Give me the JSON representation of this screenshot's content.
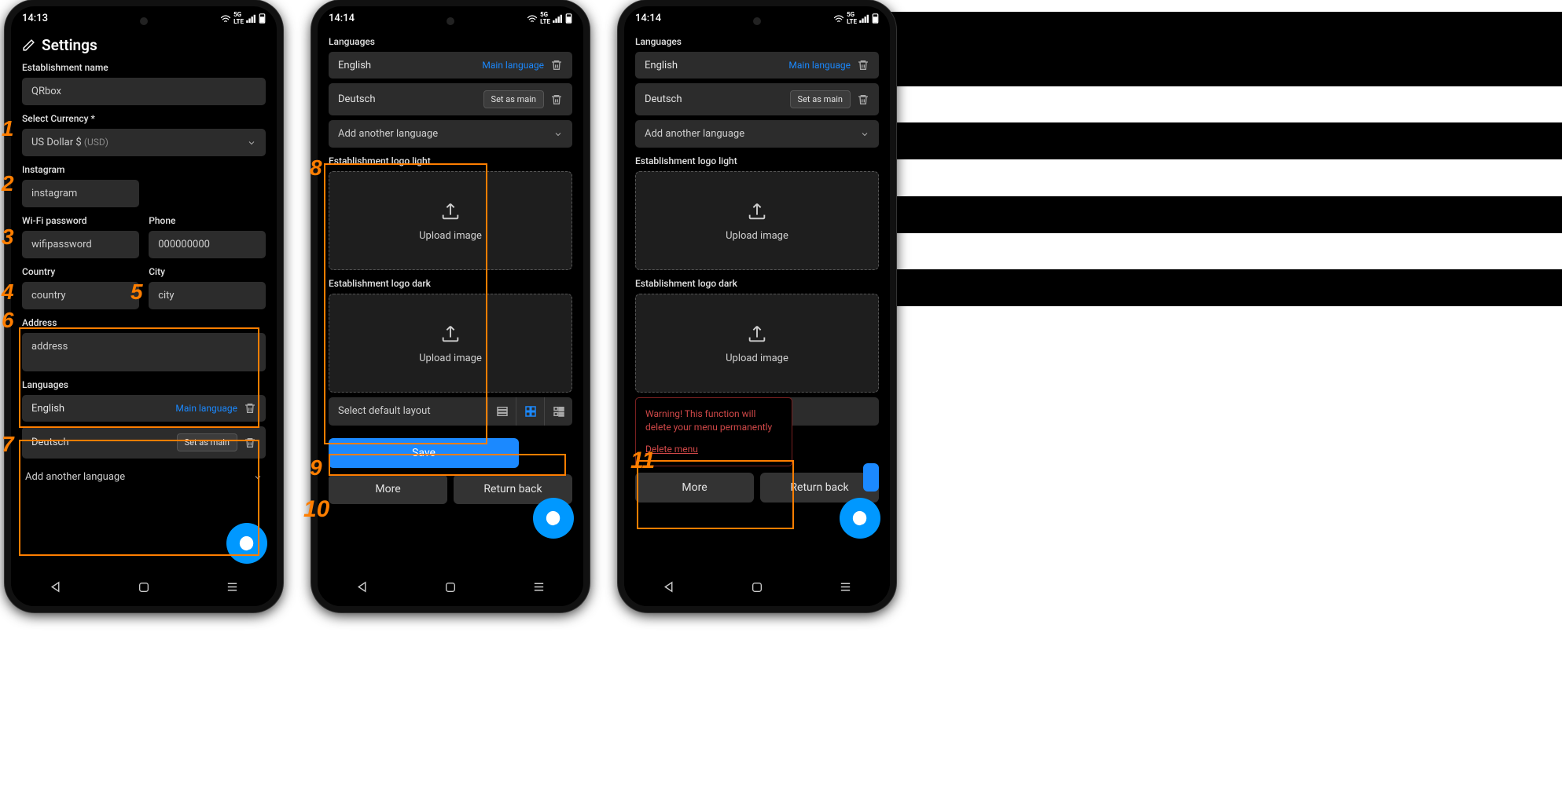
{
  "status": {
    "time1": "14:13",
    "time2": "14:14",
    "icons": "5G ᯤ ▮"
  },
  "annotations": [
    "1",
    "2",
    "3",
    "4",
    "5",
    "6",
    "7",
    "8",
    "9",
    "10",
    "11"
  ],
  "page": {
    "title": "Settings",
    "labels": {
      "est_name": "Establishment name",
      "currency": "Select Currency *",
      "instagram": "Instagram",
      "wifi": "Wi-Fi password",
      "phone": "Phone",
      "country": "Country",
      "city": "City",
      "address": "Address",
      "languages": "Languages",
      "add_lang": "Add another language",
      "logo_light": "Establishment logo light",
      "logo_dark": "Establishment logo dark",
      "upload": "Upload image",
      "layout": "Select default layout"
    },
    "values": {
      "est_name": "QRbox",
      "currency_name": "US Dollar $",
      "currency_code": "(USD)",
      "instagram": "instagram",
      "wifi": "wifipassword",
      "phone": "000000000",
      "country": "country",
      "city": "city",
      "address": "address"
    },
    "languages": [
      {
        "name": "English",
        "main": true,
        "main_label": "Main language"
      },
      {
        "name": "Deutsch",
        "main": false,
        "set_main": "Set as main"
      }
    ],
    "buttons": {
      "save": "Save",
      "more": "More",
      "return": "Return back"
    },
    "warning": {
      "text": "Warning! This function will delete your menu permanently",
      "action": "Delete menu"
    }
  }
}
